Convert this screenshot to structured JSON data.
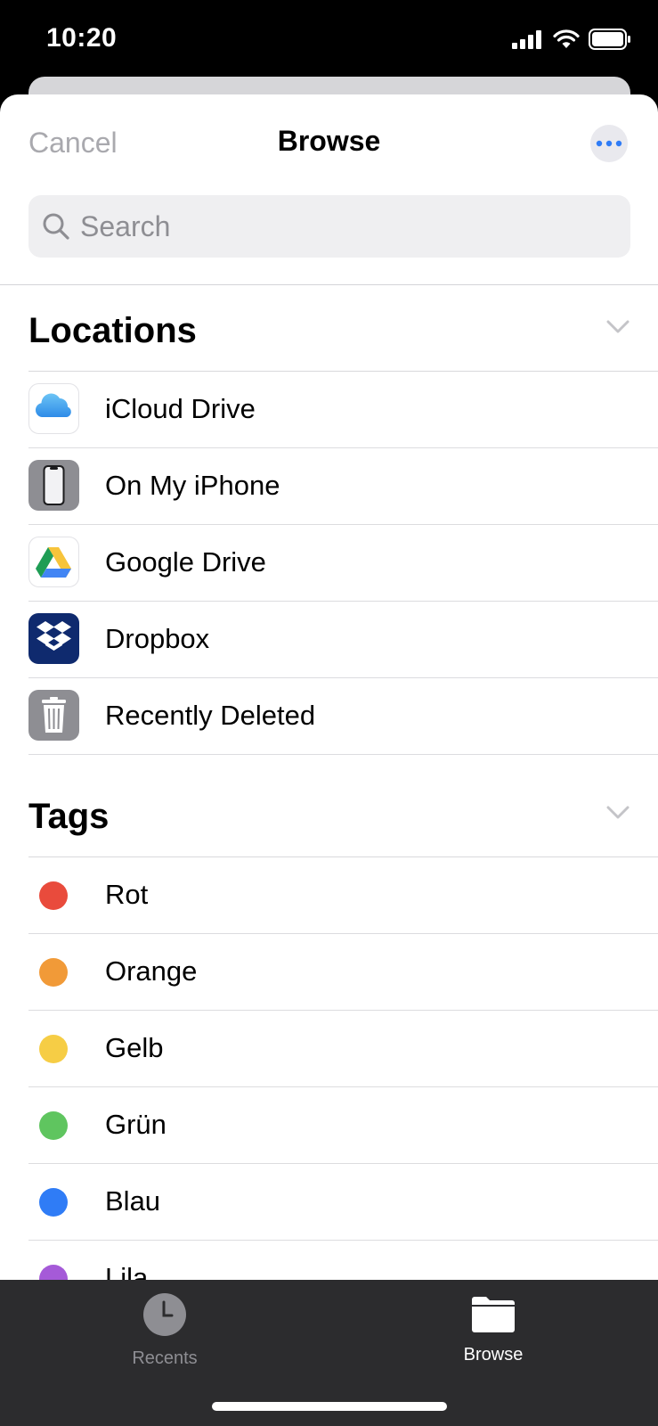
{
  "status": {
    "time": "10:20"
  },
  "nav": {
    "cancel": "Cancel",
    "title": "Browse"
  },
  "search": {
    "placeholder": "Search"
  },
  "locations": {
    "title": "Locations",
    "items": [
      {
        "label": "iCloud Drive",
        "icon": "icloud-icon"
      },
      {
        "label": "On My iPhone",
        "icon": "iphone-icon"
      },
      {
        "label": "Google Drive",
        "icon": "google-drive-icon"
      },
      {
        "label": "Dropbox",
        "icon": "dropbox-icon"
      },
      {
        "label": "Recently Deleted",
        "icon": "trash-icon"
      }
    ]
  },
  "tags": {
    "title": "Tags",
    "items": [
      {
        "label": "Rot",
        "color": "#e94b3c"
      },
      {
        "label": "Orange",
        "color": "#f19a38"
      },
      {
        "label": "Gelb",
        "color": "#f6cd45"
      },
      {
        "label": "Grün",
        "color": "#5fc55f"
      },
      {
        "label": "Blau",
        "color": "#2f7cf6"
      },
      {
        "label": "Lila",
        "color": "#a55ad8"
      }
    ]
  },
  "tabbar": {
    "recents": "Recents",
    "browse": "Browse",
    "active_color": "#ffffff",
    "inactive_color": "#8e8e93"
  }
}
